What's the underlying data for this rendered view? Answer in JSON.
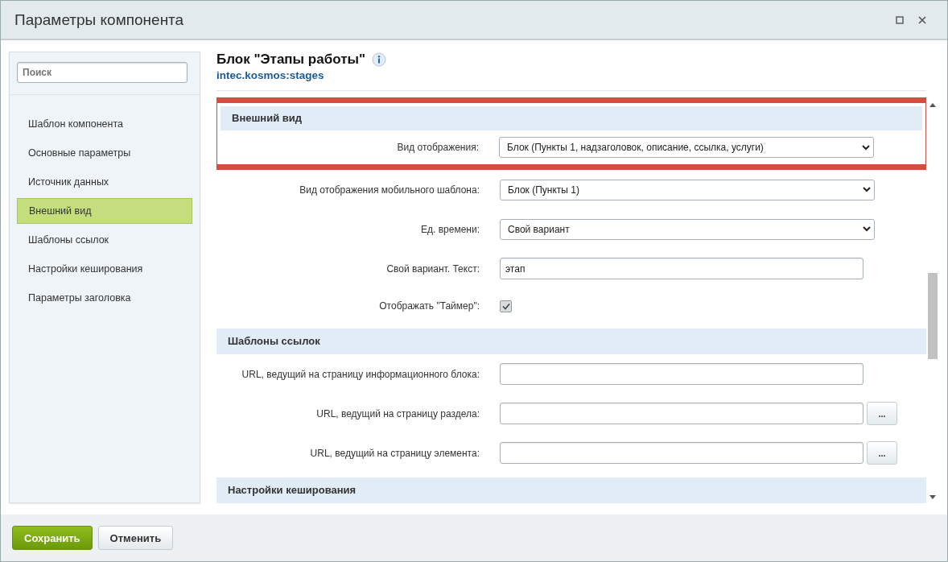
{
  "window": {
    "title": "Параметры компонента"
  },
  "sidebar": {
    "search": {
      "placeholder": "Поиск"
    },
    "items": [
      {
        "label": "Шаблон компонента",
        "selected": false
      },
      {
        "label": "Основные параметры",
        "selected": false
      },
      {
        "label": "Источник данных",
        "selected": false
      },
      {
        "label": "Внешний вид",
        "selected": true
      },
      {
        "label": "Шаблоны ссылок",
        "selected": false
      },
      {
        "label": "Настройки кеширования",
        "selected": false
      },
      {
        "label": "Параметры заголовка",
        "selected": false
      }
    ]
  },
  "component": {
    "title": "Блок \"Этапы работы\"",
    "code": "intec.kosmos:stages"
  },
  "sections": [
    {
      "title": "Внешний вид",
      "highlighted": true,
      "fields": [
        {
          "label": "Вид отображения:",
          "kind": "select",
          "value": "Блок (Пункты 1, надзаголовок, описание, ссылка, услуги)"
        },
        {
          "label": "Вид отображения мобильного шаблона:",
          "kind": "select",
          "value": "Блок (Пункты 1)"
        },
        {
          "label": "Ед. времени:",
          "kind": "select",
          "value": "Свой вариант"
        },
        {
          "label": "Свой вариант. Текст:",
          "kind": "text",
          "value": "этап"
        },
        {
          "label": "Отображать \"Таймер\":",
          "kind": "checkbox",
          "checked": true
        }
      ]
    },
    {
      "title": "Шаблоны ссылок",
      "highlighted": false,
      "fields": [
        {
          "label": "URL, ведущий на страницу информационного блока:",
          "kind": "text"
        },
        {
          "label": "URL, ведущий на страницу раздела:",
          "kind": "browse",
          "button": "..."
        },
        {
          "label": "URL, ведущий на страницу элемента:",
          "kind": "browse",
          "button": "..."
        }
      ]
    },
    {
      "title": "Настройки кеширования",
      "highlighted": false
    }
  ],
  "buttons": [
    {
      "label": "Сохранить",
      "kind": "primary"
    },
    {
      "label": "Отменить",
      "kind": "secondary"
    }
  ]
}
